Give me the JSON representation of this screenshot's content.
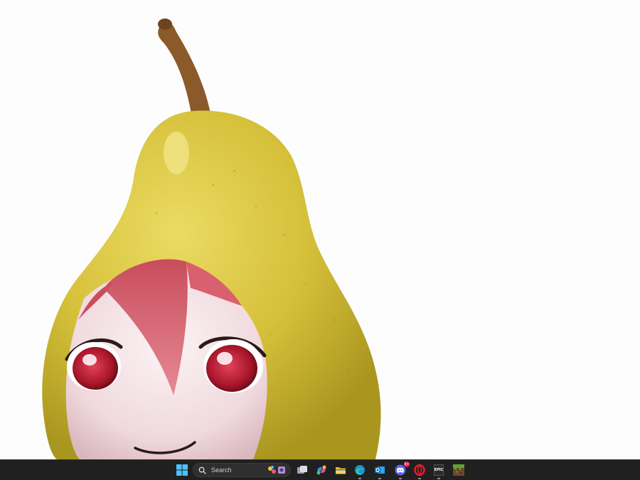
{
  "wallpaper": {
    "subject": "pear-character",
    "colors": {
      "background": "#fdfdfd",
      "pear_skin": "#d8c23c",
      "pear_shadow": "#b9a52a",
      "stem": "#8a5a2a",
      "face": "#f3dde0",
      "hair": "#d9606e",
      "eye": "#b1182c"
    }
  },
  "taskbar": {
    "background": "#202020",
    "start_icon": "windows-start-icon",
    "search": {
      "placeholder": "Search",
      "icon": "search-icon"
    },
    "pinned": [
      {
        "name": "task-view",
        "icon": "task-view-icon"
      },
      {
        "name": "copilot",
        "icon": "copilot-icon"
      },
      {
        "name": "file-explorer",
        "icon": "folder-icon"
      },
      {
        "name": "edge",
        "icon": "edge-icon"
      },
      {
        "name": "outlook",
        "icon": "outlook-icon"
      },
      {
        "name": "discord",
        "icon": "discord-icon",
        "badge": "9+"
      },
      {
        "name": "opera",
        "icon": "opera-icon"
      },
      {
        "name": "epic-games",
        "icon": "epic-games-icon",
        "label": "EPIC"
      },
      {
        "name": "minecraft",
        "icon": "minecraft-icon"
      }
    ]
  }
}
